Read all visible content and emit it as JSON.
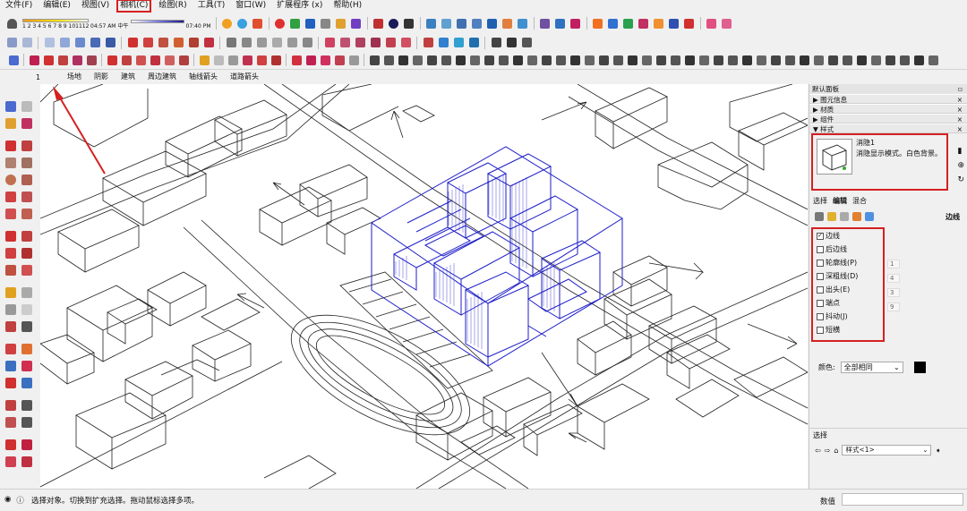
{
  "menubar": {
    "items": [
      "文件(F)",
      "编辑(E)",
      "视图(V)",
      "相机(C)",
      "绘图(R)",
      "工具(T)",
      "窗口(W)",
      "扩展程序 (x)",
      "帮助(H)"
    ]
  },
  "shadow_bar": {
    "months": "1 2 3 4 5 6 7 8 9 101112",
    "time1": "04:57 AM",
    "noon": "中午",
    "time2": "07:40 PM"
  },
  "vcb": {
    "value": "1"
  },
  "scenes": {
    "tabs": [
      "场地",
      "阴影",
      "建筑",
      "周边建筑",
      "轴线箭头",
      "道路箭头"
    ]
  },
  "panel": {
    "title": "默认面板",
    "trays": [
      {
        "label": "▶ 图元信息"
      },
      {
        "label": "▶ 材质"
      },
      {
        "label": "▶ 组件"
      },
      {
        "label": "▼ 样式"
      }
    ],
    "style": {
      "name": "消隐1",
      "description": "消隐显示模式。白色背景。"
    },
    "tabs": [
      "选择",
      "编辑",
      "混合"
    ],
    "edge_title": "边线",
    "edge_settings": [
      {
        "label": "边线",
        "checked": true
      },
      {
        "label": "后边线",
        "checked": false
      },
      {
        "label": "轮廓线(P)",
        "checked": false
      },
      {
        "label": "深粗线(D)",
        "checked": false
      },
      {
        "label": "出头(E)",
        "checked": false
      },
      {
        "label": "端点",
        "checked": false
      },
      {
        "label": "抖动(J)",
        "checked": false
      },
      {
        "label": "短横",
        "checked": false
      }
    ],
    "edge_values": [
      "1",
      "4",
      "3",
      "9"
    ],
    "color_label": "颜色:",
    "color_option": "全部相同",
    "color_value": "#000000",
    "select_tray": {
      "title": "选择",
      "dropdown": "样式<1>"
    }
  },
  "status": {
    "text": "选择对象。切换到扩充选择。拖动鼠标选择多项。",
    "measure_label": "数值"
  },
  "accent": "#d62020"
}
